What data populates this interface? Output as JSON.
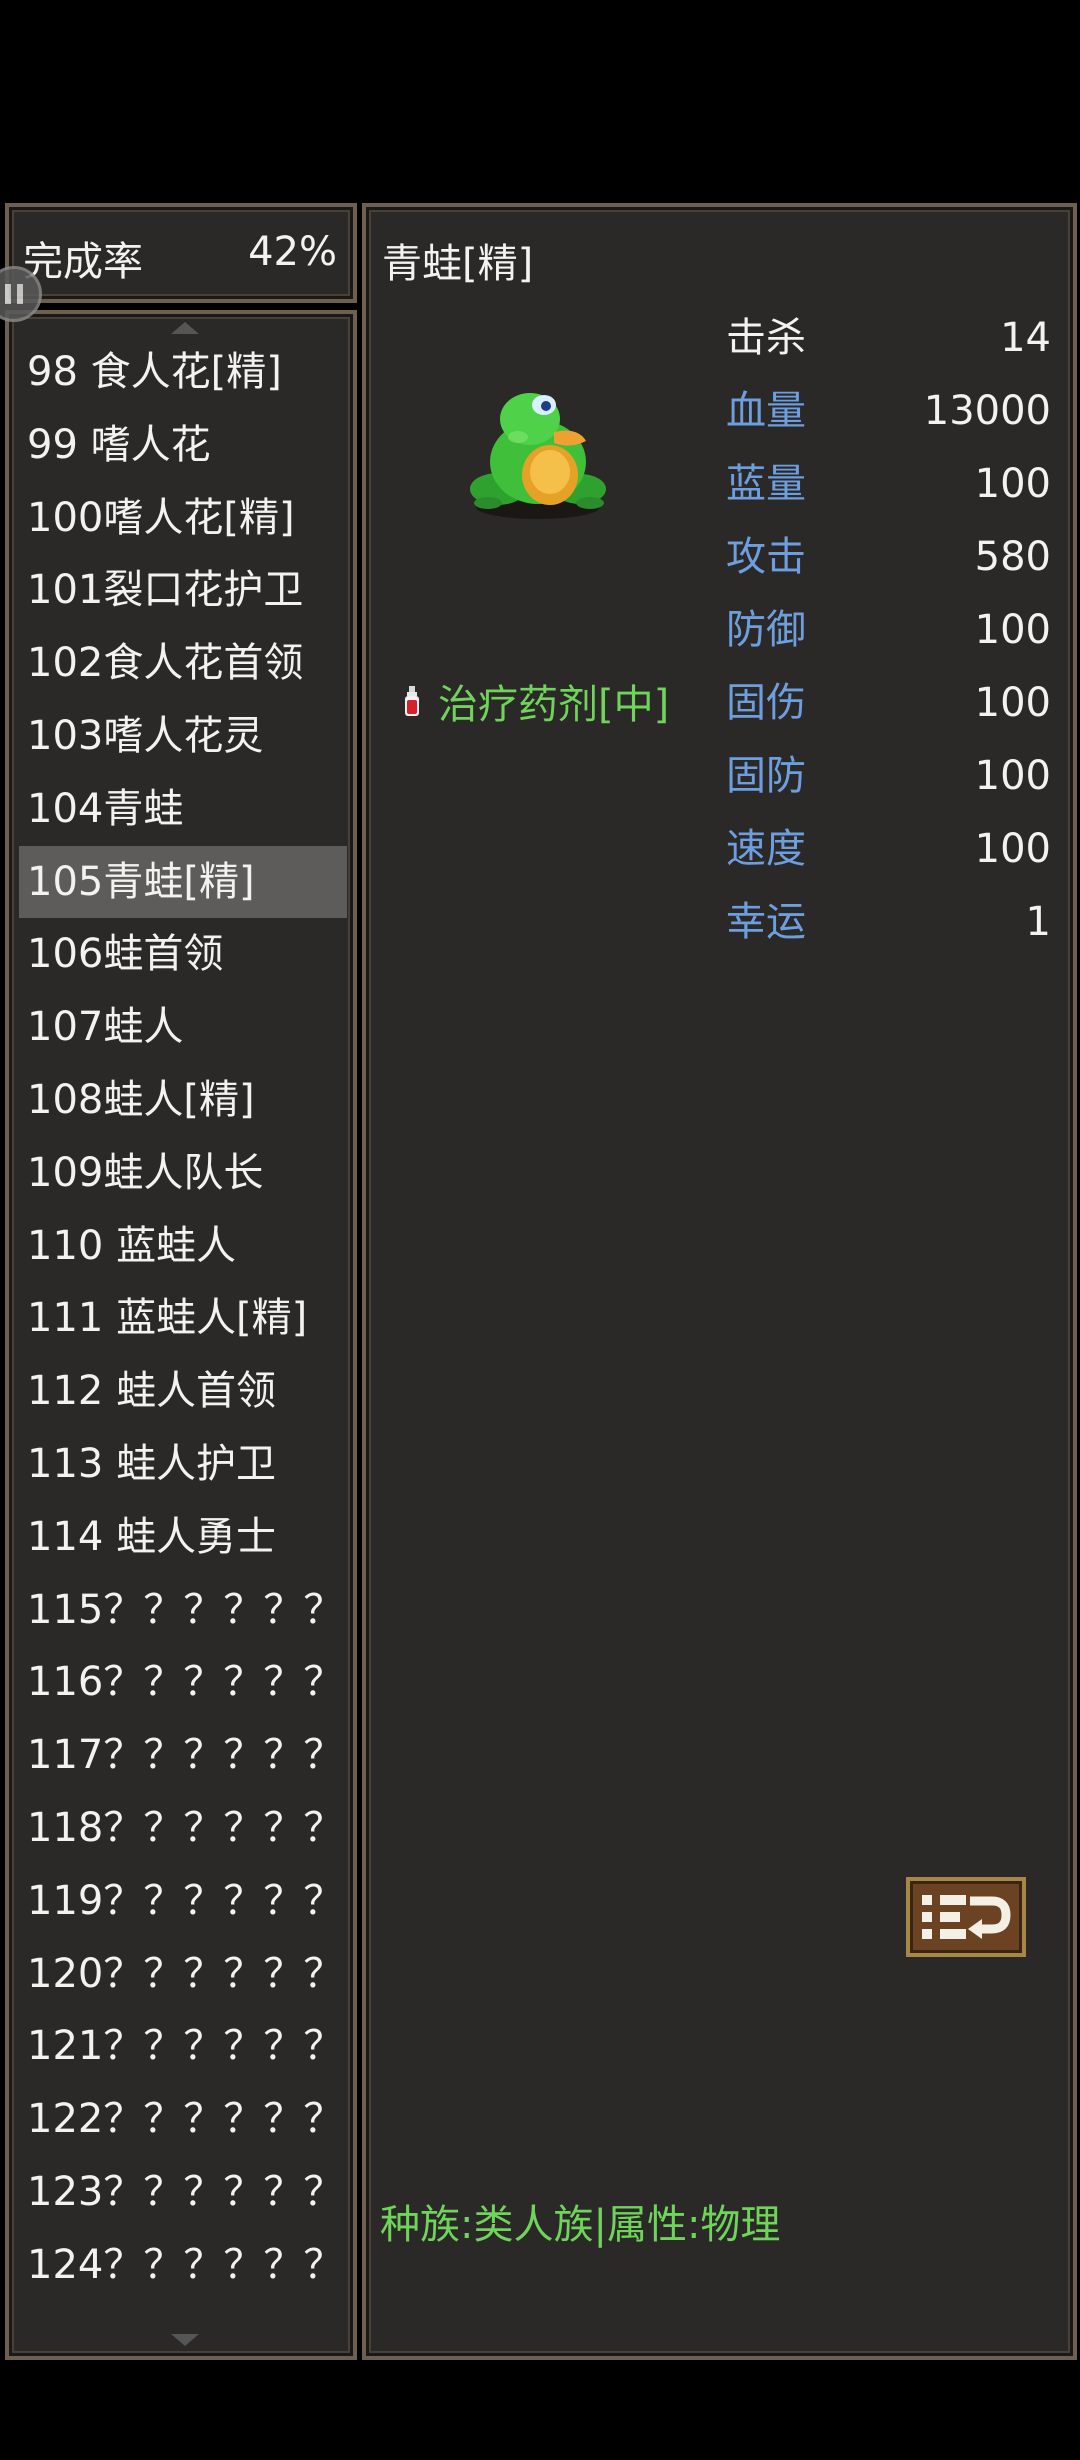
{
  "completion": {
    "label": "完成率",
    "value": "42%"
  },
  "monster_list": [
    "98 食人花[精]",
    "99 嗜人花",
    "100嗜人花[精]",
    "101裂口花护卫",
    "102食人花首领",
    "103嗜人花灵",
    "104青蛙",
    "105青蛙[精]",
    "106蛙首领",
    "107蛙人",
    "108蛙人[精]",
    "109蛙人队长",
    "110 蓝蛙人",
    "111 蓝蛙人[精]",
    "112 蛙人首领",
    "113 蛙人护卫",
    "114 蛙人勇士",
    "115？？？？？？",
    "116？？？？？？",
    "117？？？？？？",
    "118？？？？？？",
    "119？？？？？？",
    "120？？？？？？",
    "121？？？？？？",
    "122？？？？？？",
    "123？？？？？？",
    "124？？？？？？"
  ],
  "selected_index": 7,
  "detail": {
    "name": "青蛙[精]",
    "drop": "治疗药剂[中]",
    "race_info": "种族:类人族|属性:物理",
    "stats": [
      {
        "label": "击杀",
        "value": "14",
        "color": "#f2f2f2"
      },
      {
        "label": "血量",
        "value": "13000",
        "color": "#6d9fe0"
      },
      {
        "label": "蓝量",
        "value": "100",
        "color": "#6d9fe0"
      },
      {
        "label": "攻击",
        "value": "580",
        "color": "#6d9fe0"
      },
      {
        "label": "防御",
        "value": "100",
        "color": "#6d9fe0"
      },
      {
        "label": "固伤",
        "value": "100",
        "color": "#6d9fe0"
      },
      {
        "label": "固防",
        "value": "100",
        "color": "#6d9fe0"
      },
      {
        "label": "速度",
        "value": "100",
        "color": "#6d9fe0"
      },
      {
        "label": "幸运",
        "value": "1",
        "color": "#6d9fe0"
      }
    ]
  },
  "colors": {
    "stat_label": "#6d9fe0",
    "green_text": "#6fd45a",
    "panel_bg": "#2b2927"
  },
  "icons": {
    "pause": "pause-icon",
    "potion": "potion-icon",
    "swap": "swap-icon",
    "monster": "frog-sprite"
  }
}
